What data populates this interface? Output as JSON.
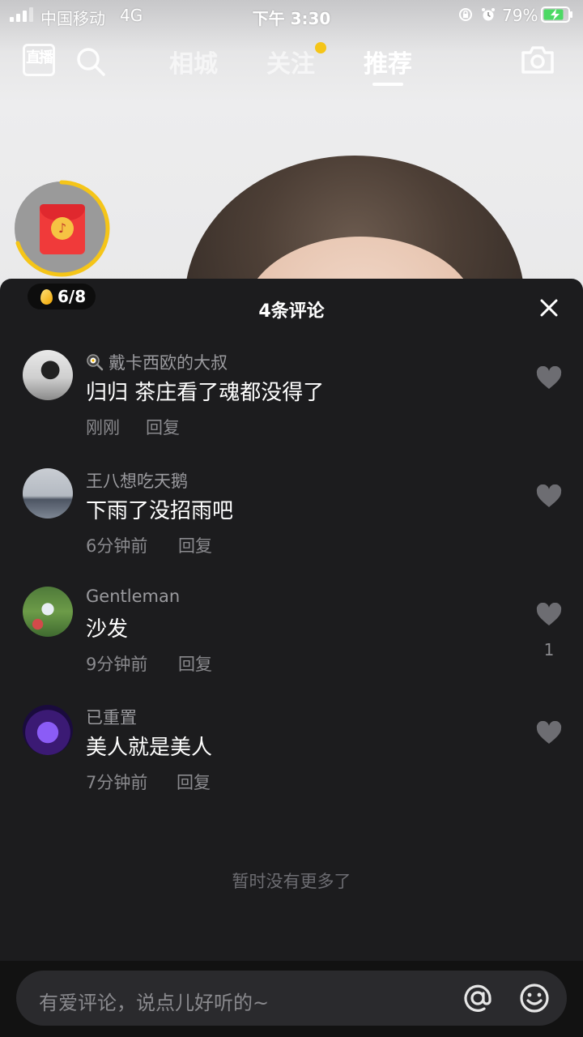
{
  "status_bar": {
    "carrier": "中国移动",
    "network": "4G",
    "time": "下午 3:30",
    "battery": "79%"
  },
  "nav": {
    "live_label": "直播",
    "tabs": [
      {
        "label": "相城",
        "active": false
      },
      {
        "label": "关注",
        "active": false,
        "has_dot": true
      },
      {
        "label": "推荐",
        "active": true
      }
    ]
  },
  "coin_counter": "6/8",
  "comments_panel": {
    "title": "4条评论",
    "comments": [
      {
        "username": "戴卡西欧的大叔",
        "text": "归归 茶庄看了魂都没得了",
        "time": "刚刚",
        "reply": "回复",
        "likes": ""
      },
      {
        "username": "王八想吃天鹅",
        "text": "下雨了没招雨吧",
        "time": "6分钟前",
        "reply": "回复",
        "likes": ""
      },
      {
        "username": "Gentleman",
        "text": "沙发",
        "time": "9分钟前",
        "reply": "回复",
        "likes": "1"
      },
      {
        "username": "已重置",
        "text": "美人就是美人",
        "time": "7分钟前",
        "reply": "回复",
        "likes": ""
      }
    ],
    "no_more": "暂时没有更多了"
  },
  "input": {
    "placeholder": "有爱评论，说点儿好听的~"
  },
  "colors": {
    "panel_bg": "#1c1c1e",
    "accent_yellow": "#f5c518",
    "red_packet": "#f03a3a"
  }
}
